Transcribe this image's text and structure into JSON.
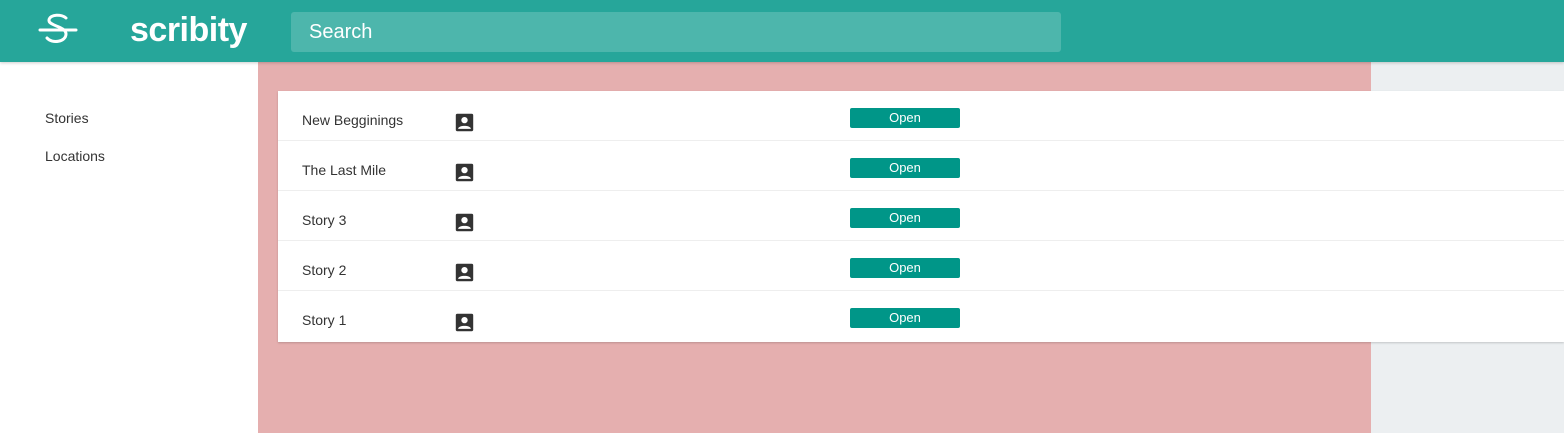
{
  "header": {
    "app_title": "scribity",
    "logo_icon": "scribity-logo-icon",
    "search_placeholder": "Search"
  },
  "sidebar": {
    "items": [
      {
        "label": "Stories"
      },
      {
        "label": "Locations"
      }
    ]
  },
  "stories": [
    {
      "title": "New Begginings",
      "icon": "account-box-icon",
      "action_label": "Open"
    },
    {
      "title": "The Last Mile",
      "icon": "account-box-icon",
      "action_label": "Open"
    },
    {
      "title": "Story 3",
      "icon": "account-box-icon",
      "action_label": "Open"
    },
    {
      "title": "Story 2",
      "icon": "account-box-icon",
      "action_label": "Open"
    },
    {
      "title": "Story 1",
      "icon": "account-box-icon",
      "action_label": "Open"
    }
  ],
  "colors": {
    "header": "#26a69a",
    "search_bg": "#4db6ac",
    "button": "#009688",
    "main_bg": "#e5afaf",
    "right_bg": "#eceff1"
  }
}
